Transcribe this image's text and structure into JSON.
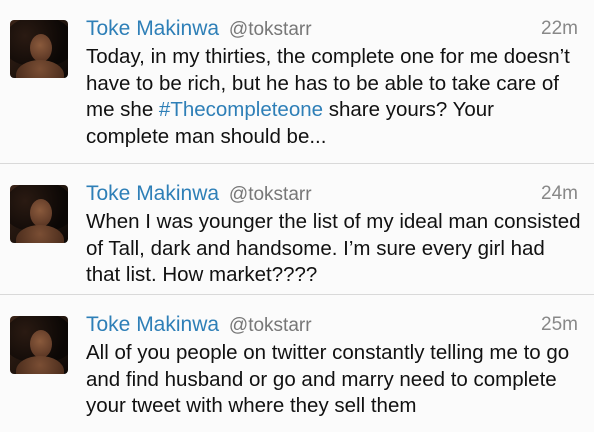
{
  "tweets": [
    {
      "display_name": "Toke Makinwa",
      "handle": "@tokstarr",
      "time": "22m",
      "text_before": "Today, in my thirties, the complete one for me doesn’t have to be rich, but he has to be able to take care of me she ",
      "hashtag": "#Thecompleteone",
      "text_after": " share yours? Your complete man should be..."
    },
    {
      "display_name": "Toke Makinwa",
      "handle": "@tokstarr",
      "time": "24m",
      "text_before": "When I was younger the list of my ideal man consisted of Tall, dark and handsome. I’m sure every girl had that list. How market????",
      "hashtag": "",
      "text_after": ""
    },
    {
      "display_name": "Toke Makinwa",
      "handle": "@tokstarr",
      "time": "25m",
      "text_before": "All of you people on twitter constantly telling me to go and find husband or go and marry need to complete your tweet with where they sell them",
      "hashtag": "",
      "text_after": ""
    }
  ]
}
